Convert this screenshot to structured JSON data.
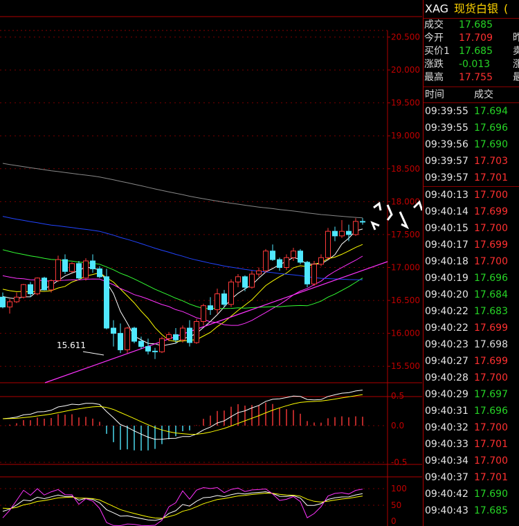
{
  "header": {
    "symbol": "XAG",
    "name": "现货白银",
    "trail": "("
  },
  "quote": [
    {
      "label": "成交",
      "value": "17.685",
      "color": "g",
      "extra": ""
    },
    {
      "label": "今开",
      "value": "17.709",
      "color": "r",
      "extra": "昨"
    },
    {
      "label": "买价1",
      "value": "17.685",
      "color": "g",
      "extra": "卖"
    },
    {
      "label": "涨跌",
      "value": "-0.013",
      "color": "g",
      "extra": "涨"
    },
    {
      "label": "最高",
      "value": "17.755",
      "color": "r",
      "extra": "最"
    }
  ],
  "ticks_header": {
    "time": "时间",
    "price": "成交"
  },
  "ticks": [
    {
      "time": "09:39:55",
      "price": "17.694",
      "color": "g"
    },
    {
      "time": "09:39:55",
      "price": "17.696",
      "color": "g"
    },
    {
      "time": "09:39:56",
      "price": "17.690",
      "color": "g"
    },
    {
      "time": "09:39:57",
      "price": "17.703",
      "color": "r"
    },
    {
      "time": "09:39:57",
      "price": "17.701",
      "color": "r"
    },
    {
      "time": "09:40:13",
      "price": "17.700",
      "color": "r"
    },
    {
      "time": "09:40:14",
      "price": "17.699",
      "color": "r"
    },
    {
      "time": "09:40:15",
      "price": "17.700",
      "color": "r"
    },
    {
      "time": "09:40:17",
      "price": "17.699",
      "color": "r"
    },
    {
      "time": "09:40:18",
      "price": "17.700",
      "color": "r"
    },
    {
      "time": "09:40:19",
      "price": "17.696",
      "color": "g"
    },
    {
      "time": "09:40:20",
      "price": "17.684",
      "color": "g"
    },
    {
      "time": "09:40:22",
      "price": "17.683",
      "color": "g"
    },
    {
      "time": "09:40:22",
      "price": "17.699",
      "color": "r"
    },
    {
      "time": "09:40:23",
      "price": "17.698",
      "color": "w"
    },
    {
      "time": "09:40:27",
      "price": "17.699",
      "color": "r"
    },
    {
      "time": "09:40:28",
      "price": "17.700",
      "color": "r"
    },
    {
      "time": "09:40:29",
      "price": "17.697",
      "color": "g"
    },
    {
      "time": "09:40:31",
      "price": "17.696",
      "color": "g"
    },
    {
      "time": "09:40:32",
      "price": "17.700",
      "color": "r"
    },
    {
      "time": "09:40:33",
      "price": "17.701",
      "color": "r"
    },
    {
      "time": "09:40:34",
      "price": "17.700",
      "color": "r"
    },
    {
      "time": "09:40:37",
      "price": "17.701",
      "color": "r"
    },
    {
      "time": "09:40:42",
      "price": "17.690",
      "color": "g"
    },
    {
      "time": "09:40:43",
      "price": "17.685",
      "color": "g"
    }
  ],
  "chart_data": {
    "type": "candlestick",
    "price_axis": [
      "20.500",
      "20.000",
      "19.500",
      "19.000",
      "18.500",
      "18.000",
      "17.500",
      "17.000",
      "16.500",
      "16.000",
      "15.500"
    ],
    "price_range": [
      15.25,
      20.6
    ],
    "low_annotation": {
      "value": "15.611",
      "price": 15.611
    },
    "macd_axis": [
      "0.0",
      "-0.5"
    ],
    "macd_top_label": "0.5",
    "kdj_axis": [
      "100",
      "50",
      "0"
    ],
    "candles": [
      [
        16.55,
        16.62,
        16.38,
        16.4
      ],
      [
        16.4,
        16.52,
        16.3,
        16.48
      ],
      [
        16.48,
        16.62,
        16.46,
        16.55
      ],
      [
        16.55,
        16.75,
        16.53,
        16.74
      ],
      [
        16.74,
        16.78,
        16.55,
        16.6
      ],
      [
        16.6,
        16.85,
        16.58,
        16.84
      ],
      [
        16.84,
        16.86,
        16.65,
        16.66
      ],
      [
        16.66,
        16.82,
        16.62,
        16.8
      ],
      [
        16.8,
        17.18,
        16.78,
        17.12
      ],
      [
        17.12,
        17.2,
        16.9,
        16.94
      ],
      [
        16.94,
        17.08,
        16.92,
        17.06
      ],
      [
        17.06,
        17.1,
        16.82,
        16.84
      ],
      [
        16.84,
        17.14,
        16.8,
        17.1
      ],
      [
        17.1,
        17.2,
        16.92,
        16.98
      ],
      [
        16.98,
        17.02,
        16.84,
        16.86
      ],
      [
        16.86,
        16.98,
        16.06,
        16.08
      ],
      [
        16.08,
        16.2,
        15.8,
        16.0
      ],
      [
        16.0,
        16.15,
        15.7,
        15.75
      ],
      [
        15.75,
        16.1,
        15.7,
        16.08
      ],
      [
        16.08,
        16.1,
        15.85,
        15.88
      ],
      [
        15.88,
        15.95,
        15.76,
        15.8
      ],
      [
        15.8,
        15.92,
        15.68,
        15.73
      ],
      [
        15.73,
        15.78,
        15.61,
        15.72
      ],
      [
        15.72,
        15.95,
        15.7,
        15.92
      ],
      [
        15.92,
        16.02,
        15.88,
        15.98
      ],
      [
        15.98,
        16.08,
        15.85,
        15.9
      ],
      [
        15.9,
        16.12,
        15.86,
        16.08
      ],
      [
        16.08,
        16.2,
        15.8,
        15.86
      ],
      [
        15.86,
        16.22,
        15.84,
        16.18
      ],
      [
        16.18,
        16.45,
        16.12,
        16.42
      ],
      [
        16.42,
        16.55,
        16.28,
        16.36
      ],
      [
        16.36,
        16.68,
        16.3,
        16.6
      ],
      [
        16.6,
        16.66,
        16.4,
        16.44
      ],
      [
        16.44,
        16.82,
        16.4,
        16.78
      ],
      [
        16.78,
        16.9,
        16.7,
        16.86
      ],
      [
        16.86,
        16.88,
        16.64,
        16.7
      ],
      [
        16.7,
        16.95,
        16.68,
        16.9
      ],
      [
        16.9,
        17.0,
        16.86,
        16.95
      ],
      [
        16.95,
        17.28,
        16.92,
        17.25
      ],
      [
        17.25,
        17.35,
        17.1,
        17.12
      ],
      [
        17.12,
        17.15,
        16.95,
        17.0
      ],
      [
        17.0,
        17.2,
        16.96,
        17.15
      ],
      [
        17.15,
        17.3,
        17.1,
        17.25
      ],
      [
        17.25,
        17.28,
        17.05,
        17.08
      ],
      [
        17.08,
        17.1,
        16.7,
        16.75
      ],
      [
        16.75,
        17.1,
        16.72,
        17.05
      ],
      [
        17.05,
        17.2,
        17.02,
        17.15
      ],
      [
        17.15,
        17.6,
        17.12,
        17.55
      ],
      [
        17.55,
        17.62,
        17.4,
        17.48
      ],
      [
        17.48,
        17.72,
        17.45,
        17.55
      ],
      [
        17.55,
        17.65,
        17.4,
        17.5
      ],
      [
        17.5,
        17.75,
        17.48,
        17.7
      ],
      [
        17.7,
        17.75,
        17.65,
        17.69
      ]
    ]
  }
}
